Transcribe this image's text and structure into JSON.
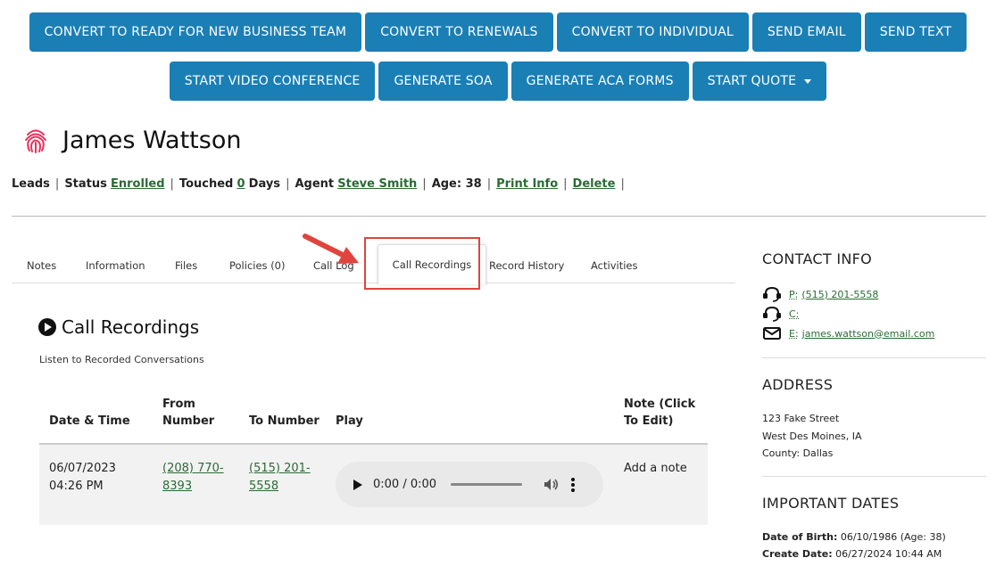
{
  "actions": {
    "row1": [
      "CONVERT TO READY FOR NEW BUSINESS TEAM",
      "CONVERT TO RENEWALS",
      "CONVERT TO INDIVIDUAL",
      "SEND EMAIL",
      "SEND TEXT"
    ],
    "row2": [
      "START VIDEO CONFERENCE",
      "GENERATE SOA",
      "GENERATE ACA FORMS",
      "START QUOTE"
    ]
  },
  "person": {
    "name": "James Wattson",
    "icon": "fingerprint-icon"
  },
  "meta": {
    "leads": "Leads",
    "status_label": "Status",
    "status_value": "Enrolled",
    "touched_label": "Touched",
    "touched_value": "0",
    "touched_unit": "Days",
    "agent_label": "Agent",
    "agent_value": "Steve Smith",
    "age": "Age: 38",
    "print": "Print Info",
    "delete": "Delete",
    "sep": "|"
  },
  "tabs": [
    "Notes",
    "Information",
    "Files",
    "Policies (0)",
    "Call Log",
    "Call Recordings",
    "Record History",
    "Activities"
  ],
  "active_tab": "Call Recordings",
  "recordings": {
    "title": "Call Recordings",
    "subtitle": "Listen to Recorded Conversations",
    "headers": {
      "datetime": "Date & Time",
      "from": "From Number",
      "to": "To Number",
      "play": "Play",
      "note": "Note (Click To Edit)"
    },
    "row": {
      "date": "06/07/2023",
      "time": "04:26 PM",
      "from_a": "(208) 770-",
      "from_b": "8393",
      "to_a": "(515) 201-",
      "to_b": "5558",
      "player_time": "0:00 / 0:00",
      "note": "Add a note"
    }
  },
  "contact": {
    "title": "CONTACT INFO",
    "phone_label": "P:",
    "phone": "(515) 201-5558",
    "cell_label": "C:",
    "email_label": "E:",
    "email": "james.wattson@email.com"
  },
  "address": {
    "title": "ADDRESS",
    "street": "123 Fake Street",
    "city": "West Des Moines, IA",
    "county": "County: Dallas"
  },
  "dates": {
    "title": "IMPORTANT DATES",
    "dob_label": "Date of Birth:",
    "dob_value": "06/10/1986 (Age: 38)",
    "create_label": "Create Date:",
    "create_value": "06/27/2024 10:44 AM"
  },
  "colors": {
    "button": "#1a7fb5",
    "link": "#2a6b34",
    "highlight": "#e0443d",
    "icon": "#e8315b"
  }
}
